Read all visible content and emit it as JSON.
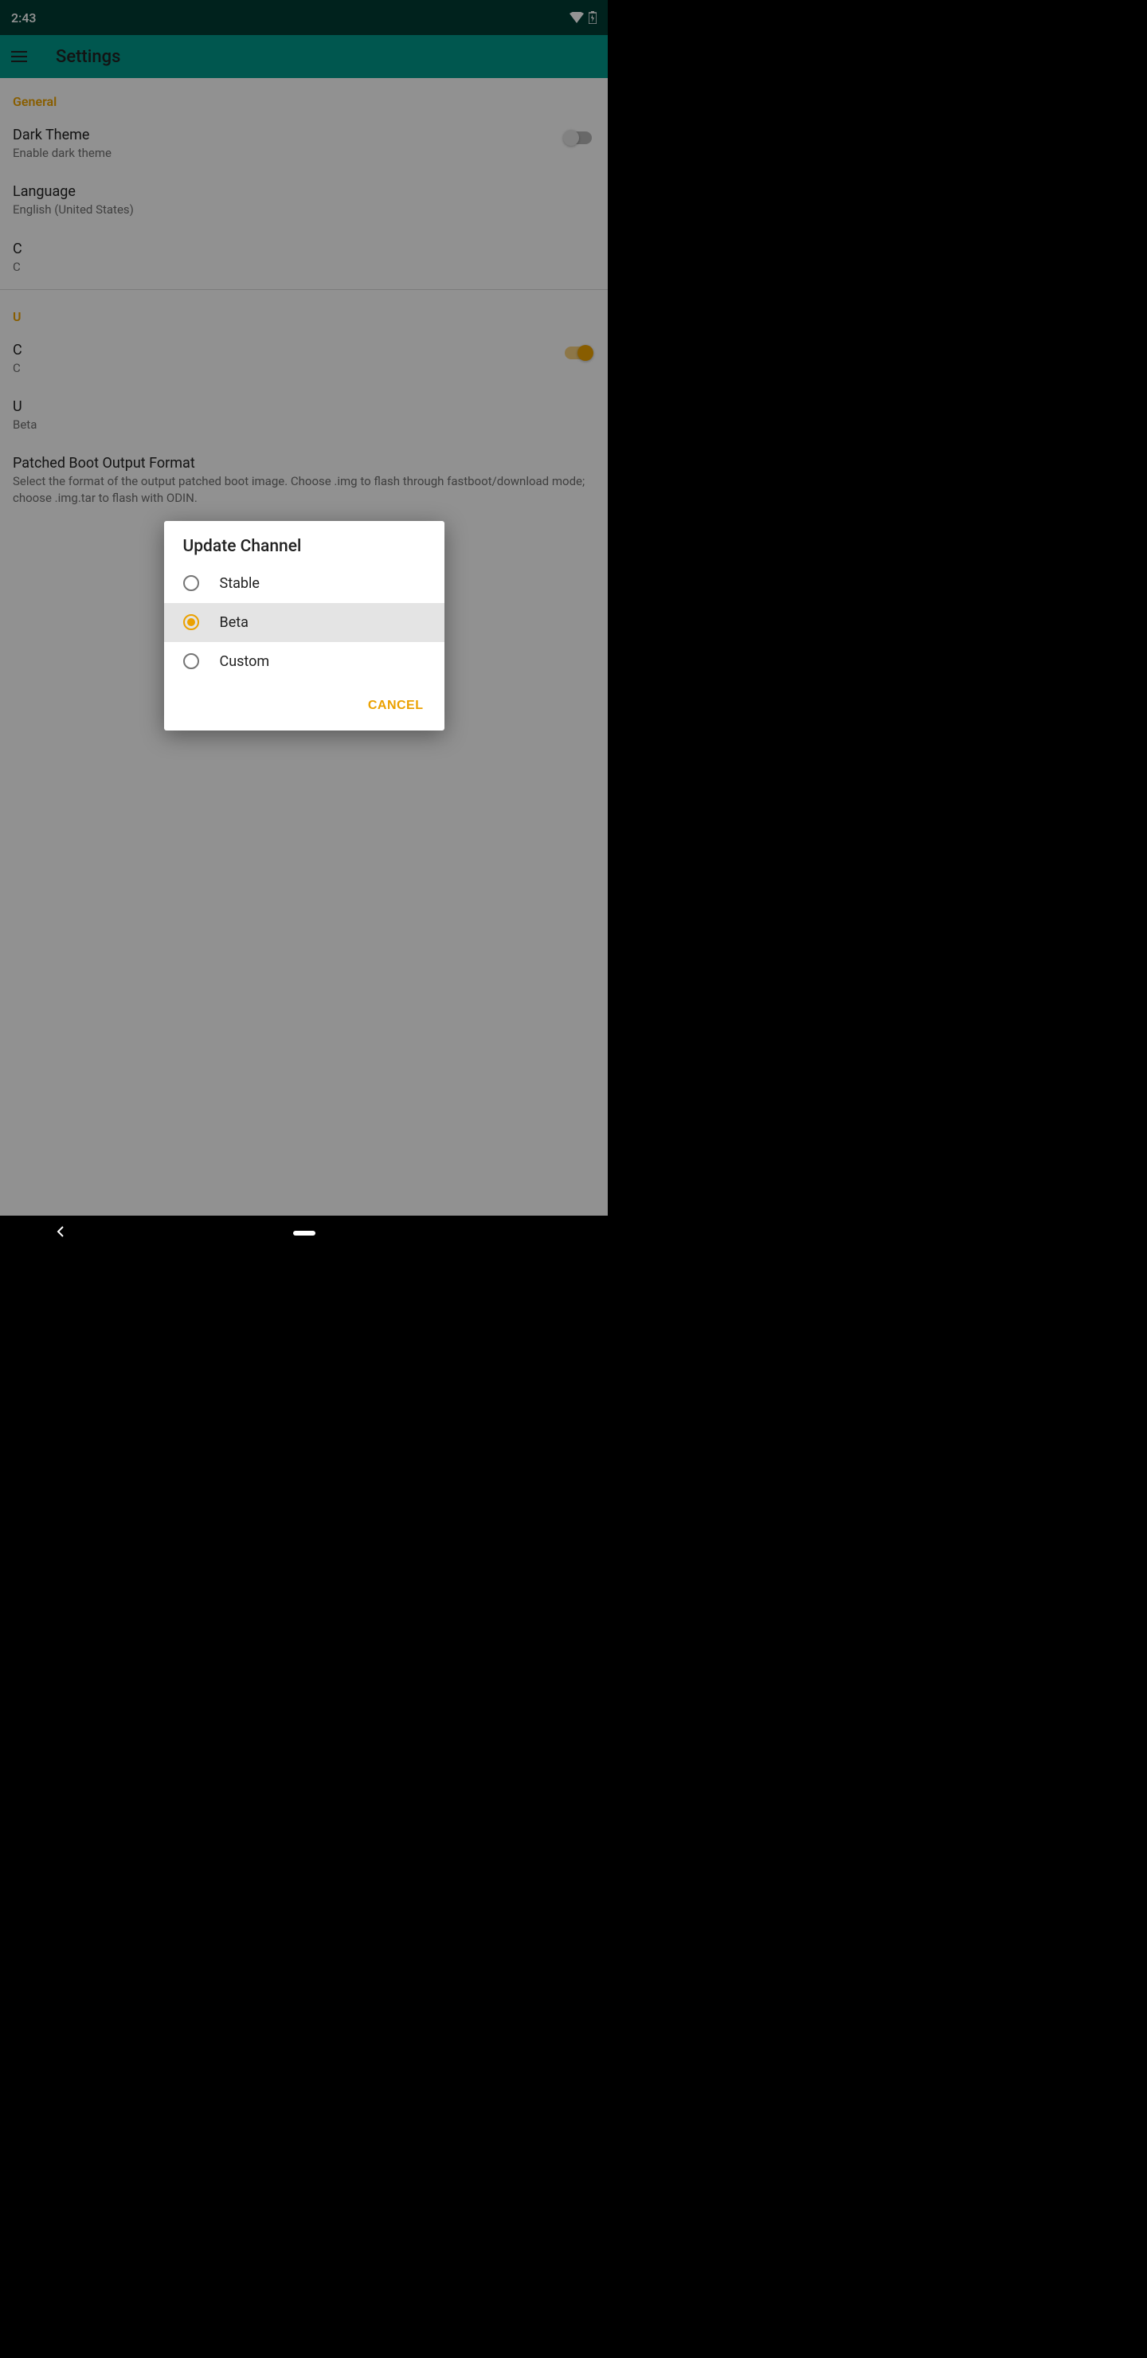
{
  "statusbar": {
    "time": "2:43"
  },
  "appbar": {
    "title": "Settings"
  },
  "sections": {
    "general": {
      "header": "General",
      "darkTheme": {
        "title": "Dark Theme",
        "sub": "Enable dark theme"
      },
      "language": {
        "title": "Language",
        "sub": "English (United States)"
      },
      "customize": {
        "title": "C",
        "sub": "C"
      }
    },
    "update": {
      "header": "U",
      "checkUpdate": {
        "title": "C",
        "sub": "C"
      },
      "updateChannel": {
        "title": "U",
        "sub": "Beta"
      },
      "patched": {
        "title": "Patched Boot Output Format",
        "sub": "Select the format of the output patched boot image. Choose .img to flash through fastboot/download mode; choose .img.tar to flash with ODIN."
      }
    }
  },
  "dialog": {
    "title": "Update Channel",
    "options": {
      "stable": "Stable",
      "beta": "Beta",
      "custom": "Custom"
    },
    "cancel": "CANCEL"
  }
}
